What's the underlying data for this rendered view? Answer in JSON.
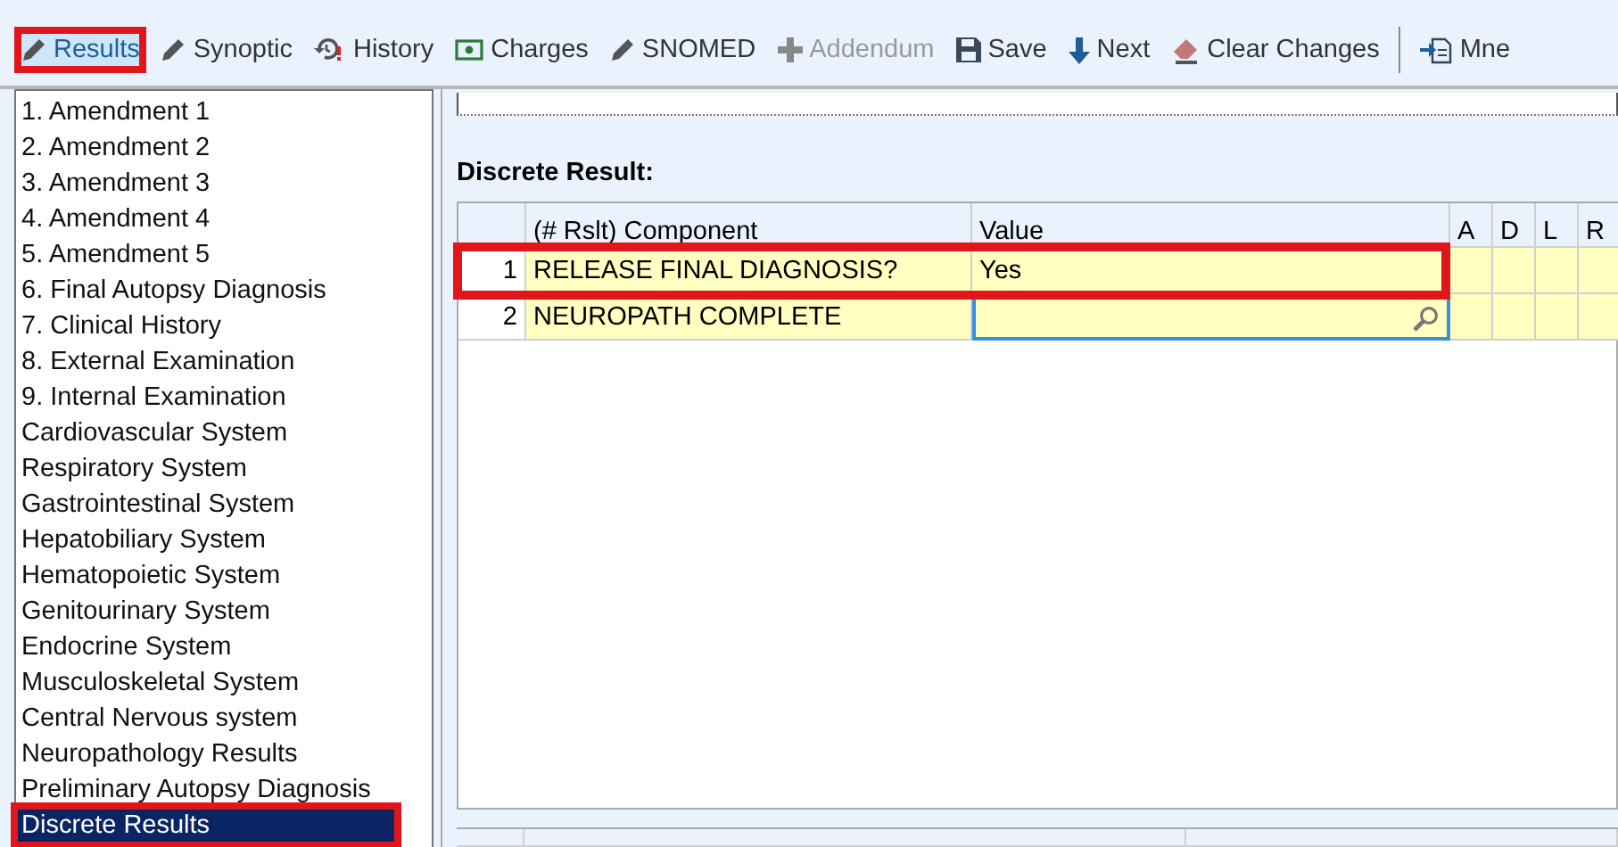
{
  "toolbar": [
    {
      "label": "Results",
      "selected": true,
      "disabled": false,
      "highlighted": true
    },
    {
      "label": "Synoptic",
      "selected": false,
      "disabled": false,
      "highlighted": false
    },
    {
      "label": "History",
      "selected": false,
      "disabled": false,
      "highlighted": false
    },
    {
      "label": "Charges",
      "selected": false,
      "disabled": false,
      "highlighted": false
    },
    {
      "label": "SNOMED",
      "selected": false,
      "disabled": false,
      "highlighted": false
    },
    {
      "label": "Addendum",
      "selected": false,
      "disabled": true,
      "highlighted": false
    },
    {
      "label": "Save",
      "selected": false,
      "disabled": false,
      "highlighted": false
    },
    {
      "label": "Next",
      "selected": false,
      "disabled": false,
      "highlighted": false
    },
    {
      "label": "Clear Changes",
      "selected": false,
      "disabled": false,
      "highlighted": false
    },
    {
      "label": "Mne",
      "selected": false,
      "disabled": false,
      "highlighted": false,
      "separator_before": true
    }
  ],
  "sections": [
    {
      "label": "1. Amendment 1",
      "selected": false,
      "highlighted": false
    },
    {
      "label": "2. Amendment 2",
      "selected": false,
      "highlighted": false
    },
    {
      "label": "3. Amendment 3",
      "selected": false,
      "highlighted": false
    },
    {
      "label": "4. Amendment 4",
      "selected": false,
      "highlighted": false
    },
    {
      "label": "5. Amendment 5",
      "selected": false,
      "highlighted": false
    },
    {
      "label": "6. Final Autopsy Diagnosis",
      "selected": false,
      "highlighted": false
    },
    {
      "label": "7. Clinical History",
      "selected": false,
      "highlighted": false
    },
    {
      "label": "8. External Examination",
      "selected": false,
      "highlighted": false
    },
    {
      "label": "9. Internal Examination",
      "selected": false,
      "highlighted": false
    },
    {
      "label": "Cardiovascular System",
      "selected": false,
      "highlighted": false
    },
    {
      "label": "Respiratory System",
      "selected": false,
      "highlighted": false
    },
    {
      "label": "Gastrointestinal System",
      "selected": false,
      "highlighted": false
    },
    {
      "label": "Hepatobiliary System",
      "selected": false,
      "highlighted": false
    },
    {
      "label": "Hematopoietic System",
      "selected": false,
      "highlighted": false
    },
    {
      "label": "Genitourinary System",
      "selected": false,
      "highlighted": false
    },
    {
      "label": "Endocrine System",
      "selected": false,
      "highlighted": false
    },
    {
      "label": "Musculoskeletal System",
      "selected": false,
      "highlighted": false
    },
    {
      "label": "Central Nervous system",
      "selected": false,
      "highlighted": false
    },
    {
      "label": "Neuropathology Results",
      "selected": false,
      "highlighted": false
    },
    {
      "label": "Preliminary Autopsy Diagnosis",
      "selected": false,
      "highlighted": false
    },
    {
      "label": "Discrete Results",
      "selected": true,
      "highlighted": true
    }
  ],
  "discrete_result": {
    "title": "Discrete Result:",
    "columns": [
      "(# Rslt) Component",
      "Value",
      "A",
      "D",
      "L",
      "R"
    ],
    "rows": [
      {
        "number": "1",
        "component": "RELEASE FINAL DIAGNOSIS?",
        "value": "Yes",
        "editing": false,
        "highlighted": true
      },
      {
        "number": "2",
        "component": "NEUROPATH COMPLETE",
        "editing": true,
        "highlighted": false
      }
    ]
  }
}
